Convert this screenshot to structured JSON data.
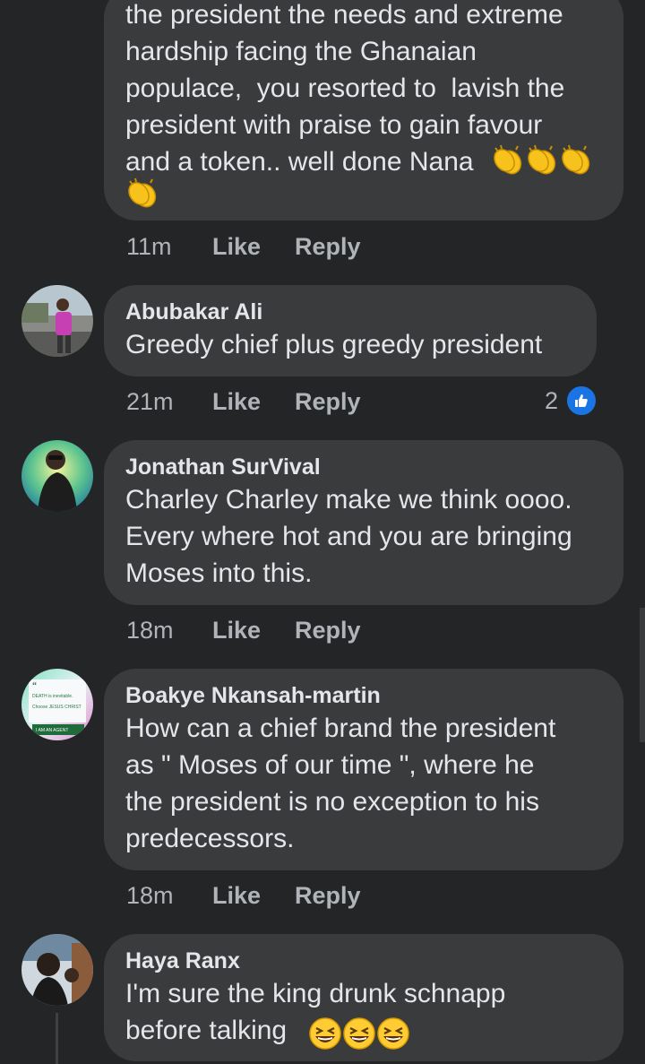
{
  "comments": [
    {
      "author": "",
      "text": "the president the needs and extreme\nhardship facing the Ghanaian\npopulace,  you resorted to  lavish the\npresident with praise to gain favour\nand a token.. well done Nana",
      "time": "11m",
      "like_label": "Like",
      "reply_label": "Reply"
    },
    {
      "author": "Abubakar Ali",
      "text": "Greedy chief plus greedy president",
      "time": "21m",
      "like_label": "Like",
      "reply_label": "Reply",
      "reaction_count": "2"
    },
    {
      "author": "Jonathan SurVival",
      "text": "Charley Charley make we think oooo.\nEvery where hot and you are bringing\nMoses into this.",
      "time": "18m",
      "like_label": "Like",
      "reply_label": "Reply"
    },
    {
      "author": "Boakye Nkansah-martin",
      "text": "How can a chief brand the president\nas \" Moses of our time \", where he\nthe president is no exception to his\npredecessors.",
      "time": "18m",
      "like_label": "Like",
      "reply_label": "Reply"
    },
    {
      "author": "Haya Ranx",
      "text": "I'm sure the king drunk schnapp\nbefore talking",
      "time": "",
      "like_label": "",
      "reply_label": ""
    }
  ],
  "avatar3_text": {
    "line1": "DEATH is inevitable.",
    "line2": "Choose JESUS CHRIST",
    "banner": "I AM AN AGENT"
  },
  "colors": {
    "background": "#242526",
    "bubble": "#3a3b3c",
    "text": "#e4e6eb",
    "meta": "#b0b3b8",
    "like_blue": "#1b74e4",
    "clap_yellow": "#f7c21c",
    "laugh_yellow": "#ffcc33"
  },
  "icons": [
    "clapping-hands-icon",
    "thumbs-up-icon",
    "laughing-face-icon"
  ]
}
